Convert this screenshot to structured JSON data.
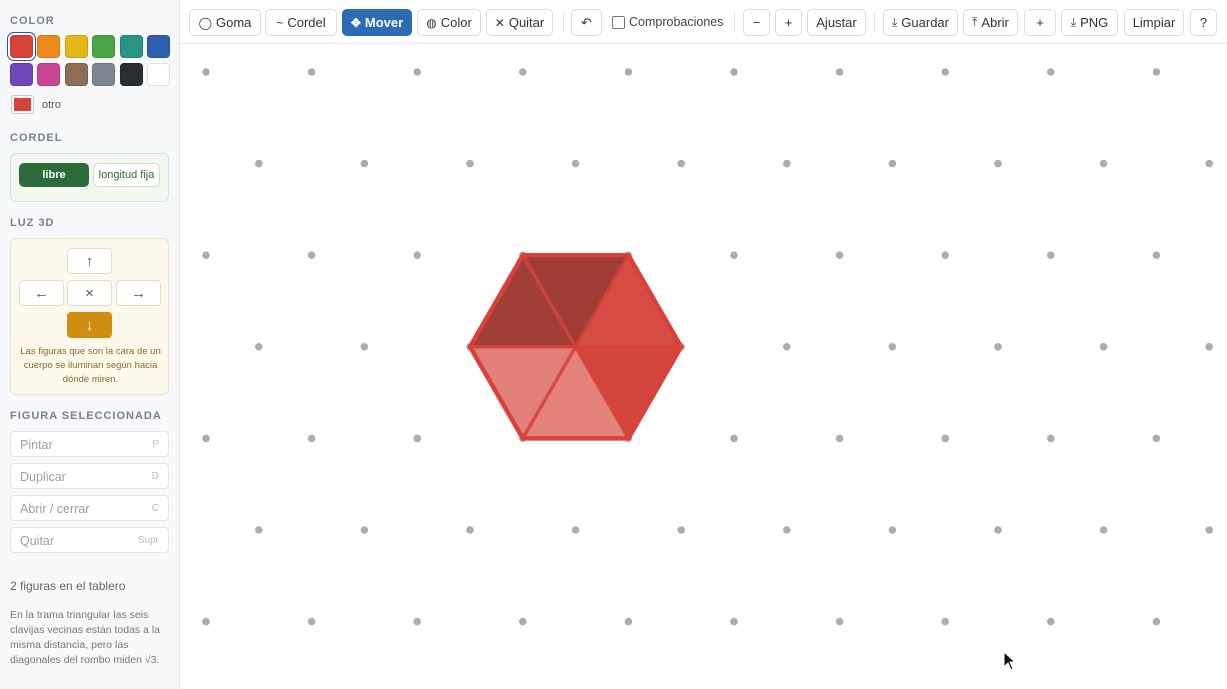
{
  "sidebar": {
    "color_title": "COLOR",
    "colors": [
      {
        "name": "red",
        "hex": "#d9423a",
        "selected": true
      },
      {
        "name": "orange",
        "hex": "#ee8a1c"
      },
      {
        "name": "yellow",
        "hex": "#e3b716"
      },
      {
        "name": "green",
        "hex": "#4aa544"
      },
      {
        "name": "teal",
        "hex": "#2a9485"
      },
      {
        "name": "blue",
        "hex": "#2d5fae"
      },
      {
        "name": "purple",
        "hex": "#6e47b8"
      },
      {
        "name": "pink",
        "hex": "#cc4595"
      },
      {
        "name": "brown",
        "hex": "#8e6c55"
      },
      {
        "name": "gray",
        "hex": "#7d8691"
      },
      {
        "name": "black",
        "hex": "#2a2d32"
      },
      {
        "name": "white",
        "hex": "#ffffff"
      }
    ],
    "custom_label": "otro",
    "custom_color": "#d9423a",
    "cordel_title": "CORDEL",
    "cordel_free": "libre",
    "cordel_fixed": "longitud fija",
    "light_title": "LUZ 3D",
    "light_up": "↑",
    "light_left": "←",
    "light_center": "×",
    "light_right": "→",
    "light_down": "↓",
    "light_note": "Las figuras que son la cara de un cuerpo se iluminan según hacia dónde miren.",
    "selected_title": "FIGURA SELECCIONADA",
    "actions": [
      {
        "label": "Pintar",
        "key": "P"
      },
      {
        "label": "Duplicar",
        "key": "D"
      },
      {
        "label": "Abrir / cerrar",
        "key": "C"
      },
      {
        "label": "Quitar",
        "key": "Supr"
      }
    ],
    "count": "2 figuras en el tablero",
    "info": "En la trama triangular las seis clavijas vecinas están todas a la misma distancia, pero las diagonales del rombo miden √3."
  },
  "toolbar": {
    "goma": "Goma",
    "cordel": "Cordel",
    "mover": "Mover",
    "color": "Color",
    "quitar": "Quitar",
    "undo": "↶",
    "checks": "Comprobaciones",
    "zoom_out": "−",
    "zoom_in": "+",
    "fit": "Ajustar",
    "save": "Guardar",
    "open": "Abrir",
    "add": "+",
    "png": "PNG",
    "clear": "Limpiar",
    "help": "?"
  },
  "board": {
    "peg_color": "#a9adb5",
    "shape_stroke": "#d9423a",
    "faces": [
      {
        "name": "top-left",
        "color": "#a13f39"
      },
      {
        "name": "top",
        "color": "#9f3d37"
      },
      {
        "name": "top-right",
        "color": "#d64b42"
      },
      {
        "name": "bottom-right",
        "color": "#d4463d"
      },
      {
        "name": "bottom",
        "color": "#e2827a"
      },
      {
        "name": "bottom-left",
        "color": "#e1807a"
      }
    ]
  }
}
